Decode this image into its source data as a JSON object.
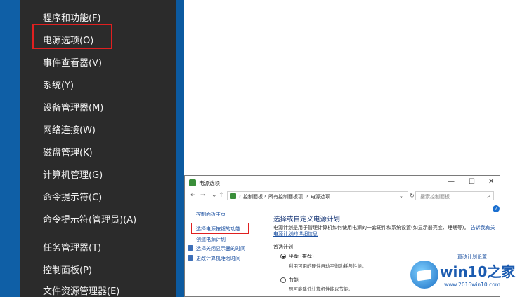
{
  "winx_menu": {
    "items": [
      {
        "label": "程序和功能(F)"
      },
      {
        "label": "电源选项(O)"
      },
      {
        "label": "事件查看器(V)"
      },
      {
        "label": "系统(Y)"
      },
      {
        "label": "设备管理器(M)"
      },
      {
        "label": "网络连接(W)"
      },
      {
        "label": "磁盘管理(K)"
      },
      {
        "label": "计算机管理(G)"
      },
      {
        "label": "命令提示符(C)"
      },
      {
        "label": "命令提示符(管理员)(A)"
      },
      {
        "label": "任务管理器(T)"
      },
      {
        "label": "控制面板(P)"
      },
      {
        "label": "文件资源管理器(E)"
      }
    ],
    "highlighted_item": "电源选项(O)"
  },
  "power_window": {
    "title": "电源选项",
    "controls": {
      "minimize": "—",
      "maximize": "☐",
      "close": "✕"
    },
    "address": [
      "控制面板",
      "所有控制面板项",
      "电源选项"
    ],
    "search_placeholder": "搜索控制面板",
    "left_links": [
      "控制面板主页",
      "选择电源按钮的功能",
      "创建电源计划",
      "选择关闭显示器的时间",
      "更改计算机睡眠时间"
    ],
    "main_title": "选择或自定义电源计划",
    "description": "电源计划是用于管理计算机如何使用电源的一套硬件和系统设置(如显示器亮度、睡眠等)。",
    "description_link": "告诉我有关电源计划的详细信息",
    "plan_section": "首选计划",
    "plans": [
      {
        "name": "平衡 (推荐)",
        "desc": "利用可用的硬件自动平衡功耗与性能。",
        "selected": true
      },
      {
        "name": "节能",
        "desc": "尽可能降低计算机性能以节能。",
        "selected": false
      }
    ],
    "change_link": "更改计划设置"
  },
  "watermark": {
    "title": "win10之家",
    "url": "www.2016win10.com"
  },
  "colors": {
    "menu_bg": "#2b2b2b",
    "highlight": "#e02020",
    "accent": "#0f5fa6"
  }
}
